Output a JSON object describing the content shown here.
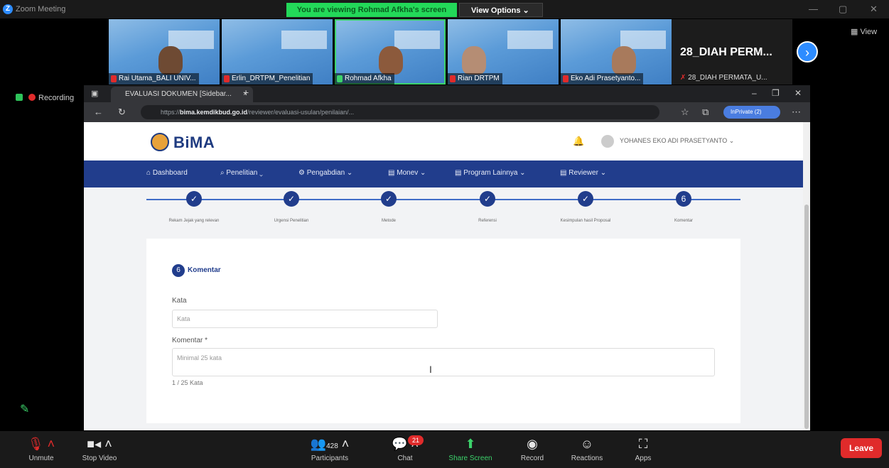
{
  "zoom": {
    "app_title": "Zoom Meeting",
    "share_banner": "You are viewing Rohmad Afkha's screen",
    "view_options": "View Options",
    "view_label": "View",
    "recording_label": "Recording"
  },
  "participants": [
    {
      "name": "Rai Utama_BALI UNIV..."
    },
    {
      "name": "Erlin_DRTPM_Penelitian"
    },
    {
      "name": "Rohmad Afkha"
    },
    {
      "name": "Rian DRTPM"
    },
    {
      "name": "Eko Adi Prasetyanto..."
    },
    {
      "big": "28_DIAH PERM...",
      "name": "28_DIAH PERMATA_U..."
    }
  ],
  "browser": {
    "tab_title": "EVALUASI DOKUMEN [Sidebar...",
    "url_domain": "bima.kemdikbud.go.id",
    "url_prefix": "https://",
    "url_rest": "/reviewer/evaluasi-usulan/penilaian/...",
    "profile_label": "InPrivate (2)"
  },
  "page": {
    "brand": "BiMA",
    "user": "YOHANES EKO ADI PRASETYANTO",
    "menu": [
      "Dashboard",
      "Penelitian",
      "Pengabdian",
      "Monev",
      "Program Lainnya",
      "Reviewer"
    ],
    "steps": [
      {
        "label": "Rekam Jejak yang relevan",
        "mark": "✓"
      },
      {
        "label": "Urgensi Penelitian",
        "mark": "✓"
      },
      {
        "label": "Metode",
        "mark": "✓"
      },
      {
        "label": "Referensi",
        "mark": "✓"
      },
      {
        "label": "Kesimpulan hasil Proposal",
        "mark": "✓"
      },
      {
        "label": "Komentar",
        "mark": "6"
      }
    ],
    "section_number": "6",
    "section_title": "Komentar",
    "kata_label": "Kata",
    "kata_placeholder": "Kata",
    "komentar_label": "Komentar *",
    "komentar_placeholder": "Minimal 25 kata",
    "counter": "1 / 25 Kata"
  },
  "toolbar": {
    "unmute": "Unmute",
    "stop_video": "Stop Video",
    "participants": "Participants",
    "participants_count": "428",
    "chat": "Chat",
    "chat_badge": "21",
    "share_screen": "Share Screen",
    "record": "Record",
    "reactions": "Reactions",
    "apps": "Apps",
    "leave": "Leave"
  }
}
